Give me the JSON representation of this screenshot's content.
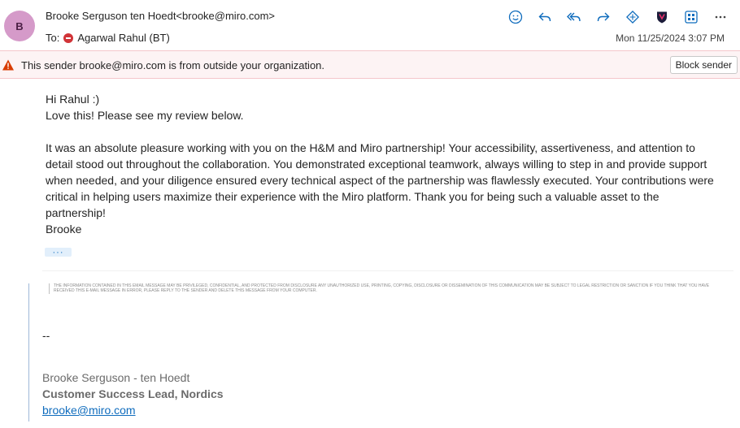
{
  "header": {
    "avatar_initial": "B",
    "sender": "Brooke Serguson ten Hoedt<brooke@miro.com>",
    "to_label": "To:",
    "recipient": "Agarwal Rahul (BT)",
    "timestamp": "Mon 11/25/2024 3:07 PM"
  },
  "toolbar": {
    "icons": [
      "emoji-icon",
      "reply-icon",
      "reply-all-icon",
      "forward-icon",
      "teams-share-icon",
      "shield-icon",
      "apps-icon",
      "more-icon"
    ]
  },
  "warning": {
    "text": "This sender brooke@miro.com is from outside your organization.",
    "block_label": "Block sender"
  },
  "body": {
    "greeting": "Hi Rahul :)",
    "line2": "Love this! Please see my review below.",
    "paragraph": "It was an absolute pleasure working with you on the H&M and Miro partnership! Your accessibility, assertiveness, and attention to detail stood out throughout the collaboration. You demonstrated exceptional teamwork, always willing to step in and provide support when needed, and your diligence ensured every technical aspect of the partnership was flawlessly executed. Your contributions were critical in helping users maximize their experience with the Miro platform. Thank you for being such a valuable asset to the partnership!",
    "signoff": "Brooke",
    "more_label": "···"
  },
  "quoted": {
    "disclaimer": "THE INFORMATION CONTAINED IN THIS EMAIL MESSAGE MAY BE PRIVILEGED, CONFIDENTIAL, AND PROTECTED FROM DISCLOSURE ANY UNAUTHORIZED USE, PRINTING, COPYING, DISCLOSURE OR DISSEMINATION OF THIS COMMUNICATION MAY BE SUBJECT TO LEGAL RESTRICTION OR SANCTION IF YOU THINK THAT YOU HAVE RECEIVED THIS E-MAIL MESSAGE IN ERROR, PLEASE REPLY TO THE SENDER AND DELETE THIS MESSAGE FROM YOUR COMPUTER.",
    "sig_dash": "--",
    "sig_name": "Brooke Serguson - ten Hoedt",
    "sig_title": "Customer Success Lead, Nordics",
    "sig_email": "brooke@miro.com"
  },
  "colors": {
    "accent": "#0f6cbd",
    "avatar_bg": "#d59ac9",
    "warning_bg": "#fdf3f4",
    "warning_icon": "#d83b01",
    "blocked_red": "#d13438"
  }
}
